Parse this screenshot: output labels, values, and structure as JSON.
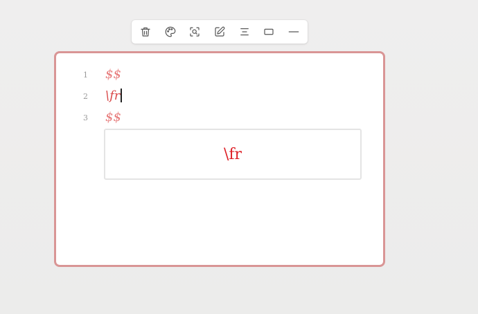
{
  "toolbar": {
    "buttons": [
      {
        "icon": "trash-icon",
        "name": "delete-button"
      },
      {
        "icon": "palette-icon",
        "name": "color-button"
      },
      {
        "icon": "zoom-search-icon",
        "name": "zoom-button"
      },
      {
        "icon": "edit-icon",
        "name": "edit-button"
      },
      {
        "icon": "align-center-icon",
        "name": "align-button"
      },
      {
        "icon": "rectangle-icon",
        "name": "shape-button"
      },
      {
        "icon": "line-icon",
        "name": "line-button"
      }
    ]
  },
  "editor": {
    "lines": [
      {
        "number": "1",
        "code": "$$"
      },
      {
        "number": "2",
        "code": "\\fr"
      },
      {
        "number": "3",
        "code": "$$"
      }
    ]
  },
  "preview": {
    "rendered": "\\fr"
  },
  "colors": {
    "card_border": "#d99595",
    "code_text": "#e77a7a",
    "preview_text": "#dd1f26"
  }
}
